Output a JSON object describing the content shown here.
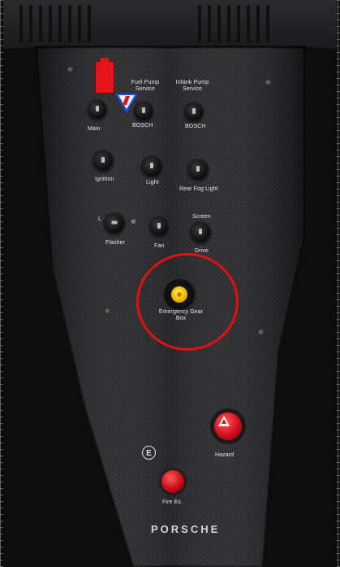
{
  "labels": {
    "main": "Main",
    "fuel_pump_service": "Fuel Pump Service",
    "fuel_pump_brand": "BOSCH",
    "infank_pump_service": "Infank Pump Service",
    "infank_pump_brand": "BOSCH",
    "ignition": "Ignition",
    "light": "Light",
    "rear_fog_light": "Rear Fog Light",
    "flasher": "Flasher",
    "flasher_left": "L",
    "flasher_right": "R",
    "fan": "Fan",
    "screen": "Screen",
    "drive": "Drive",
    "emergency_gear_box": "Emergency Gear Box",
    "hazard": "Hazard",
    "fire_ex": "Fire Ex.",
    "e_symbol": "E",
    "brand": "PORSCHE"
  },
  "colors": {
    "highlight_circle": "#e21010",
    "hazard_button": "#d10d1a",
    "emergency_button": "#f3c300",
    "warning_triangle": "#1c4fcf"
  },
  "icons": {
    "main_lock": "red-lock-tab-icon",
    "warning": "electric-warning-triangle-icon",
    "hazard": "hazard-triangle-icon"
  }
}
